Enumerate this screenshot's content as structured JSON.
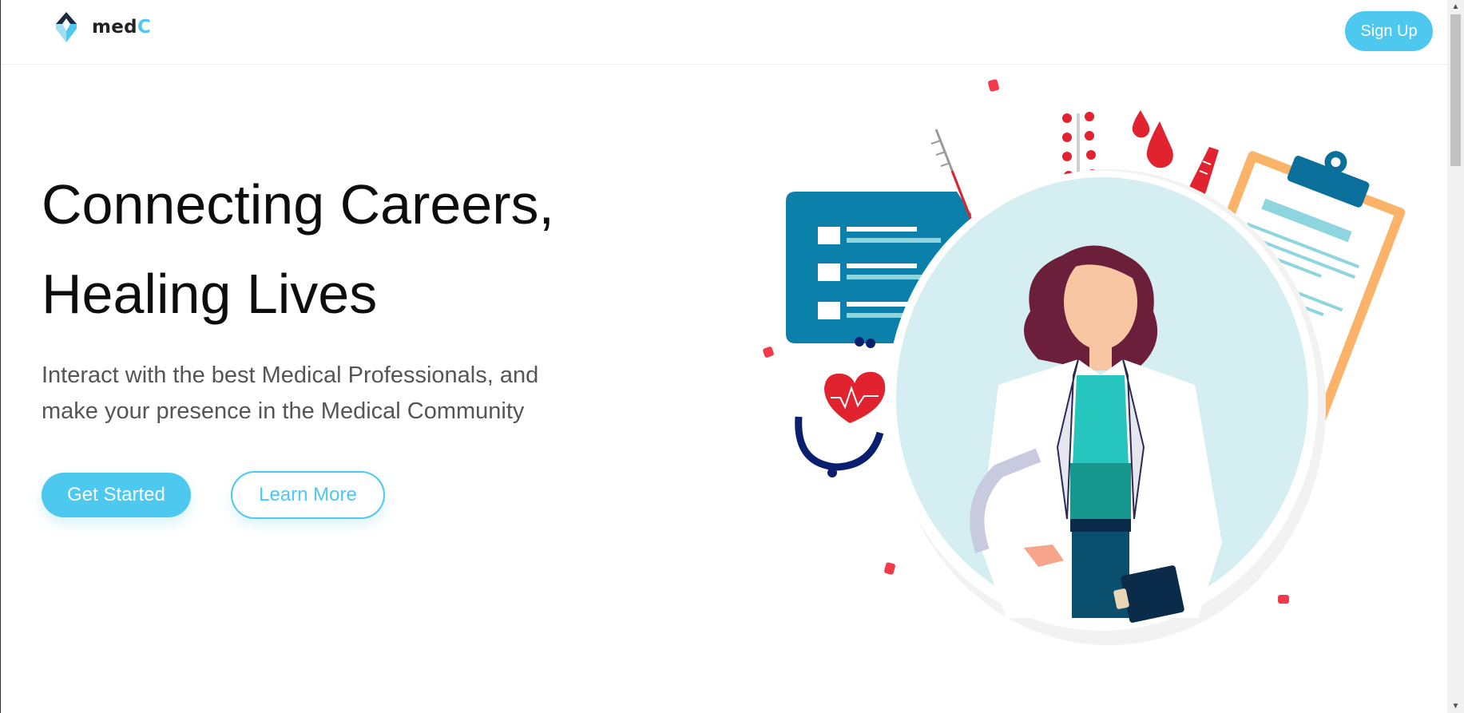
{
  "nav": {
    "logo_text": "med",
    "logo_text_accent": "C",
    "signup_label": "Sign Up"
  },
  "hero": {
    "title_line1": "Connecting Careers,",
    "title_line2": "Healing Lives",
    "subtitle_line1": "Interact with the best Medical Professionals, and",
    "subtitle_line2": "make your presence in the Medical Community",
    "get_started_label": "Get Started",
    "learn_more_label": "Learn More"
  },
  "scrollbar": {
    "up_arrow": "▲",
    "down_arrow": "▼"
  },
  "colors": {
    "accent": "#4dc8ef",
    "text_dark": "#0d0d0d",
    "text_muted": "#555555"
  },
  "illustration": {
    "description_icon": "doctor-illustration",
    "icons": [
      "doctor-icon",
      "clipboard-icon",
      "chat-bubble-icon",
      "heart-icon",
      "stethoscope-icon",
      "thermometer-icon",
      "pills-icon",
      "blood-drops-icon",
      "test-tube-icon"
    ]
  }
}
